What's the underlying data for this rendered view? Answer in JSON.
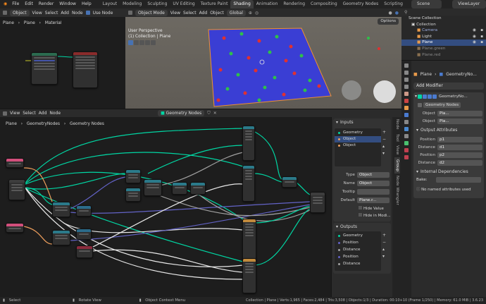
{
  "menu": {
    "file": "File",
    "edit": "Edit",
    "render": "Render",
    "window": "Window",
    "help": "Help"
  },
  "workspaces": [
    "Layout",
    "Modeling",
    "Sculpting",
    "UV Editing",
    "Texture Paint",
    "Shading",
    "Animation",
    "Rendering",
    "Compositing",
    "Geometry Nodes",
    "Scripting"
  ],
  "active_workspace": "Shading",
  "scene_name": "Scene",
  "view_layer": "ViewLayer",
  "shader_editor": {
    "mode": "Object",
    "menus": [
      "View",
      "Select",
      "Add",
      "Node"
    ],
    "use_nodes": "Use Node",
    "breadcrumb": [
      "Plane",
      "Plane",
      "Material"
    ]
  },
  "viewport": {
    "mode": "Object Mode",
    "menus": [
      "View",
      "Select",
      "Add",
      "Object"
    ],
    "transform": "Global",
    "title": "User Perspective",
    "subtitle": "(1) Collection | Plane",
    "options": "Options"
  },
  "outliner": {
    "rows": [
      {
        "label": "Scene Collection",
        "color": "#ddd"
      },
      {
        "label": "Collection",
        "color": "#ddd"
      },
      {
        "label": "Camera",
        "color": "#9ad"
      },
      {
        "label": "Light",
        "color": "#ddd"
      },
      {
        "label": "Plane",
        "color": "#fff"
      },
      {
        "label": "Plane.green",
        "color": "#8a8a8a"
      },
      {
        "label": "Plane.red",
        "color": "#8a8a8a"
      }
    ]
  },
  "geo_editor": {
    "menus": [
      "View",
      "Select",
      "Add",
      "Node"
    ],
    "tree_name": "Geometry Nodes",
    "breadcrumb": [
      "Plane",
      "GeometryNodes",
      "Geometry Nodes"
    ]
  },
  "group_panel": {
    "inputs_title": "Inputs",
    "inputs": [
      {
        "label": "Geometry",
        "color": "#00d6a3"
      },
      {
        "label": "Object",
        "color": "#ed9e5c"
      },
      {
        "label": "Object",
        "color": "#ed9e5c"
      }
    ],
    "selected_input": 1,
    "type_label": "Type",
    "type_value": "Object",
    "name_label": "Name",
    "name_value": "Object",
    "tooltip_label": "Tooltip",
    "tooltip_value": "",
    "default_label": "Default",
    "default_value": "Plane.r...",
    "hide_value": "Hide Value",
    "hide_in_modifier": "Hide in Modi...",
    "outputs_title": "Outputs",
    "outputs": [
      {
        "label": "Geometry",
        "color": "#00d6a3"
      },
      {
        "label": "Position",
        "color": "#6363c7"
      },
      {
        "label": "Distance",
        "color": "#a1a1a1"
      },
      {
        "label": "Position",
        "color": "#6363c7"
      },
      {
        "label": "Distance",
        "color": "#a1a1a1"
      }
    ],
    "sidebar_tabs": [
      "Node",
      "Tool",
      "View",
      "Group",
      "Node Wrangler"
    ]
  },
  "properties": {
    "object_name": "Plane",
    "modifier_dropdown": "GeometryNo...",
    "add_modifier": "Add Modifier",
    "modifier_name": "GeometryNo...",
    "node_group": "Geometry Nodes",
    "object_fields": [
      {
        "label": "Object",
        "value": "Pla..."
      },
      {
        "label": "Object",
        "value": "Pla..."
      }
    ],
    "output_attributes_title": "Output Attributes",
    "output_attributes": [
      {
        "label": "Position",
        "value": "p1"
      },
      {
        "label": "Distance",
        "value": "d1"
      },
      {
        "label": "Position",
        "value": "p2"
      },
      {
        "label": "Distance",
        "value": "d2"
      }
    ],
    "internal_deps": "Internal Dependencies",
    "bake_label": "Bake:",
    "no_named": "No named attributes used"
  },
  "status_bar": {
    "select": "Select",
    "rotate": "Rotate View",
    "context": "Object Context Menu",
    "stats": "Collection | Plane | Verts:1,965 | Faces:2,484 | Tris:3,508 | Objects:1/3 | Duration: 00:10+10 (Frame 1/250) | Memory: 61.0 MiB | 3.6.23"
  },
  "colors": {
    "accent": "#4772b3",
    "plane_blue": "#3a3ed4",
    "geometry_socket": "#00d6a3",
    "object_socket": "#ed9e5c"
  }
}
